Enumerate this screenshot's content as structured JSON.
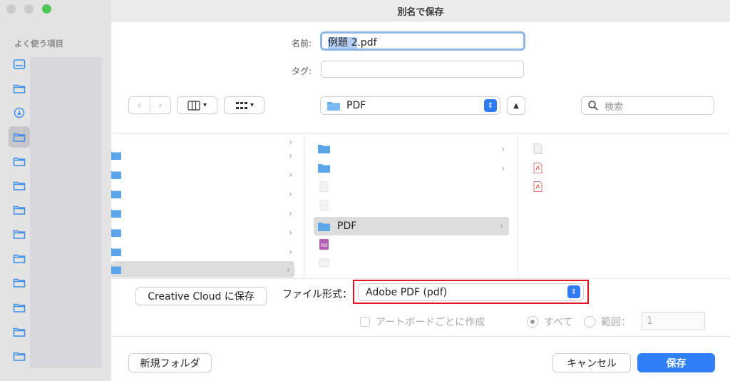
{
  "window": {
    "title": "別名で保存"
  },
  "sidebar": {
    "heading": "よく使う項目",
    "icons": [
      "drive-icon",
      "folder-icon",
      "download-icon",
      "folder-icon",
      "folder-icon",
      "folder-icon",
      "folder-icon",
      "folder-icon",
      "folder-icon",
      "folder-icon",
      "folder-icon",
      "folder-icon",
      "folder-icon"
    ]
  },
  "form": {
    "name_label": "名前:",
    "name_selected": "例題 2",
    "name_extension": ".pdf",
    "tag_label": "タグ:"
  },
  "toolbar": {
    "back_icon": "chevron-left-icon",
    "forward_icon": "chevron-right-icon",
    "path_label": "PDF",
    "search_placeholder": "検索"
  },
  "browser": {
    "selected_folder": "PDF"
  },
  "options": {
    "creative_cloud_button": "Creative Cloud に保存",
    "file_format_label": "ファイル形式：",
    "file_format_value": "Adobe PDF (pdf)",
    "artboard_label": "アートボードごとに作成",
    "all_label": "すべて",
    "range_label": "範囲：",
    "range_value": "1"
  },
  "buttons": {
    "new_folder": "新規フォルダ",
    "cancel": "キャンセル",
    "save": "保存"
  },
  "colors": {
    "accent": "#2f80f6",
    "highlight_box": "#e0141e",
    "folder": "#5aa6e8"
  }
}
